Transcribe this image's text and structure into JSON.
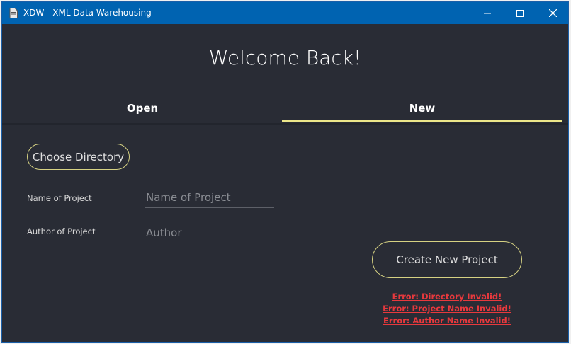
{
  "window": {
    "title": "XDW - XML Data Warehousing",
    "icon": "document-icon",
    "controls": {
      "minimize": "minimize-icon",
      "maximize": "maximize-icon",
      "close": "close-icon"
    }
  },
  "welcome": "Welcome Back!",
  "tabs": [
    {
      "label": "Open",
      "selected": false
    },
    {
      "label": "New",
      "selected": true
    }
  ],
  "form": {
    "choose_directory_label": "Choose Directory",
    "project_name_label": "Name of Project",
    "project_name_placeholder": "Name of Project",
    "project_name_value": "",
    "author_label": "Author of Project",
    "author_placeholder": "Author",
    "author_value": "",
    "create_label": "Create New Project"
  },
  "errors": [
    "Error: Directory Invalid!",
    "Error: Project Name Invalid!",
    "Error: Author Name Invalid!"
  ],
  "colors": {
    "titlebar": "#0063b1",
    "background": "#292c35",
    "accent": "#ece78a",
    "error": "#e8393d"
  }
}
